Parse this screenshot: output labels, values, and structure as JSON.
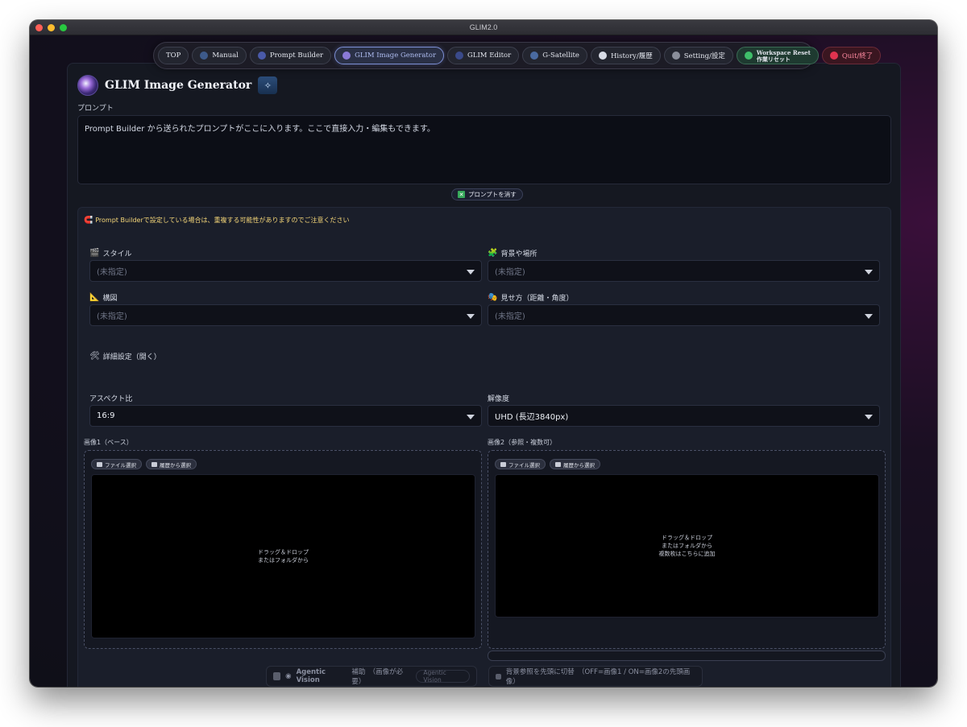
{
  "window": {
    "title": "GLIM2.0"
  },
  "nav": {
    "items": [
      {
        "label": "TOP",
        "icon": "none"
      },
      {
        "label": "Manual",
        "icon": "manual-icon"
      },
      {
        "label": "Prompt Builder",
        "icon": "builder-icon"
      },
      {
        "label": "GLIM Image Generator",
        "icon": "generator-icon",
        "active": true
      },
      {
        "label": "GLIM Editor",
        "icon": "editor-icon"
      },
      {
        "label": "G-Satellite",
        "icon": "satellite-icon"
      },
      {
        "label": "History/履歴",
        "icon": "history-icon"
      },
      {
        "label": "Setting/設定",
        "icon": "gear-icon"
      }
    ],
    "reset_line1": "Workspace Reset",
    "reset_line2": "作業リセット",
    "quit_label": "Quit/終了"
  },
  "page": {
    "title": "GLIM Image Generator",
    "prompt_label": "プロンプト",
    "prompt_text": "Prompt Builder から送られたプロンプトがここに入ります。ここで直接入力・編集もできます。",
    "clear_label": "プロンプトを消す"
  },
  "settings": {
    "warning": "Prompt Builderで設定している場合は、重複する可能性がありますのでご注意ください",
    "style_label": "スタイル",
    "style_value": "(未指定)",
    "background_label": "背景や場所",
    "background_value": "(未指定)",
    "composition_label": "構図",
    "composition_value": "(未指定)",
    "view_label": "見せ方（距離・角度）",
    "view_value": "(未指定)",
    "advanced_label": "詳細設定（開く）",
    "aspect_label": "アスペクト比",
    "aspect_value": "16:9",
    "resolution_label": "解像度",
    "resolution_value": "UHD (長辺3840px)"
  },
  "images": {
    "image1_label": "画像1（ベース）",
    "image2_label": "画像2（参照・複数可）",
    "file_select": "ファイル選択",
    "history_select": "履歴から選択",
    "drop1_line1": "ドラッグ＆ドロップ",
    "drop1_line2": "またはフォルダから",
    "drop2_line1": "ドラッグ＆ドロップ",
    "drop2_line2": "またはフォルダから",
    "drop2_line3": "複数枚はこちらに追加"
  },
  "options": {
    "agentic_label": "Agentic Vision",
    "agentic_suffix": "補助　（画像が必要）",
    "agentic_button": "Agentic Vision",
    "bg_ref_label": "背景参照を先頭に切替　（OFF=画像1 / ON=画像2の先頭画像）"
  },
  "colors": {
    "accent": "#7d8fd4",
    "warning": "#f5d678",
    "reset": "#1e3a30",
    "quit": "#3a1620"
  }
}
